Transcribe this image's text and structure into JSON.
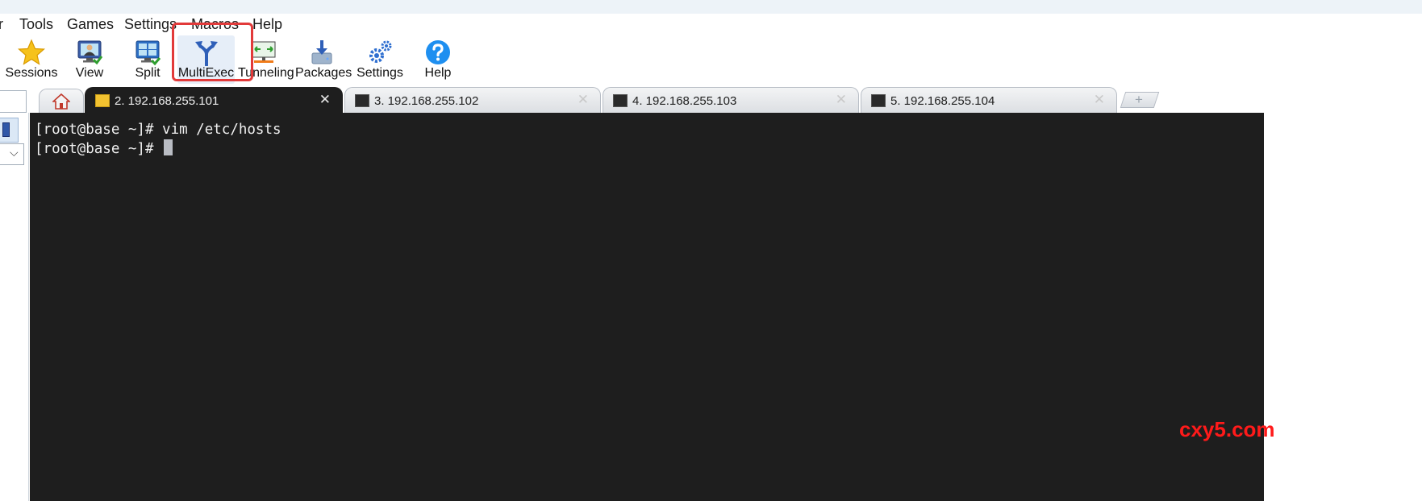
{
  "menubar": {
    "items": [
      "r",
      "Tools",
      "Games",
      "Settings",
      "Macros",
      "Help"
    ]
  },
  "toolbar": {
    "buttons": [
      {
        "label": "Sessions",
        "icon": "star-icon"
      },
      {
        "label": "View",
        "icon": "monitor-user-icon"
      },
      {
        "label": "Split",
        "icon": "split-screen-icon"
      },
      {
        "label": "MultiExec",
        "icon": "fork-arrow-icon"
      },
      {
        "label": "Tunneling",
        "icon": "tunnel-icon"
      },
      {
        "label": "Packages",
        "icon": "download-box-icon"
      },
      {
        "label": "Settings",
        "icon": "gears-icon"
      },
      {
        "label": "Help",
        "icon": "question-icon"
      }
    ],
    "active": "MultiExec"
  },
  "tabs": {
    "home_icon": "home-icon",
    "items": [
      {
        "label": "2. 192.168.255.101",
        "close": "✕",
        "active": true
      },
      {
        "label": "3. 192.168.255.102",
        "close": "✕",
        "active": false
      },
      {
        "label": "4. 192.168.255.103",
        "close": "✕",
        "active": false
      },
      {
        "label": "5. 192.168.255.104",
        "close": "✕",
        "active": false
      }
    ],
    "new_tab": "+"
  },
  "terminal": {
    "lines": [
      "[root@base ~]# vim /etc/hosts",
      "[root@base ~]# "
    ],
    "background": "#1e1e1e",
    "foreground": "#f0f0f0"
  },
  "sidebar": {
    "select_chevron": "⌵"
  },
  "watermark": {
    "text": "cxy5.com",
    "color": "#ff1a1a"
  },
  "colors": {
    "highlight": "#e23a3a",
    "accent_blue": "#2196f3"
  }
}
